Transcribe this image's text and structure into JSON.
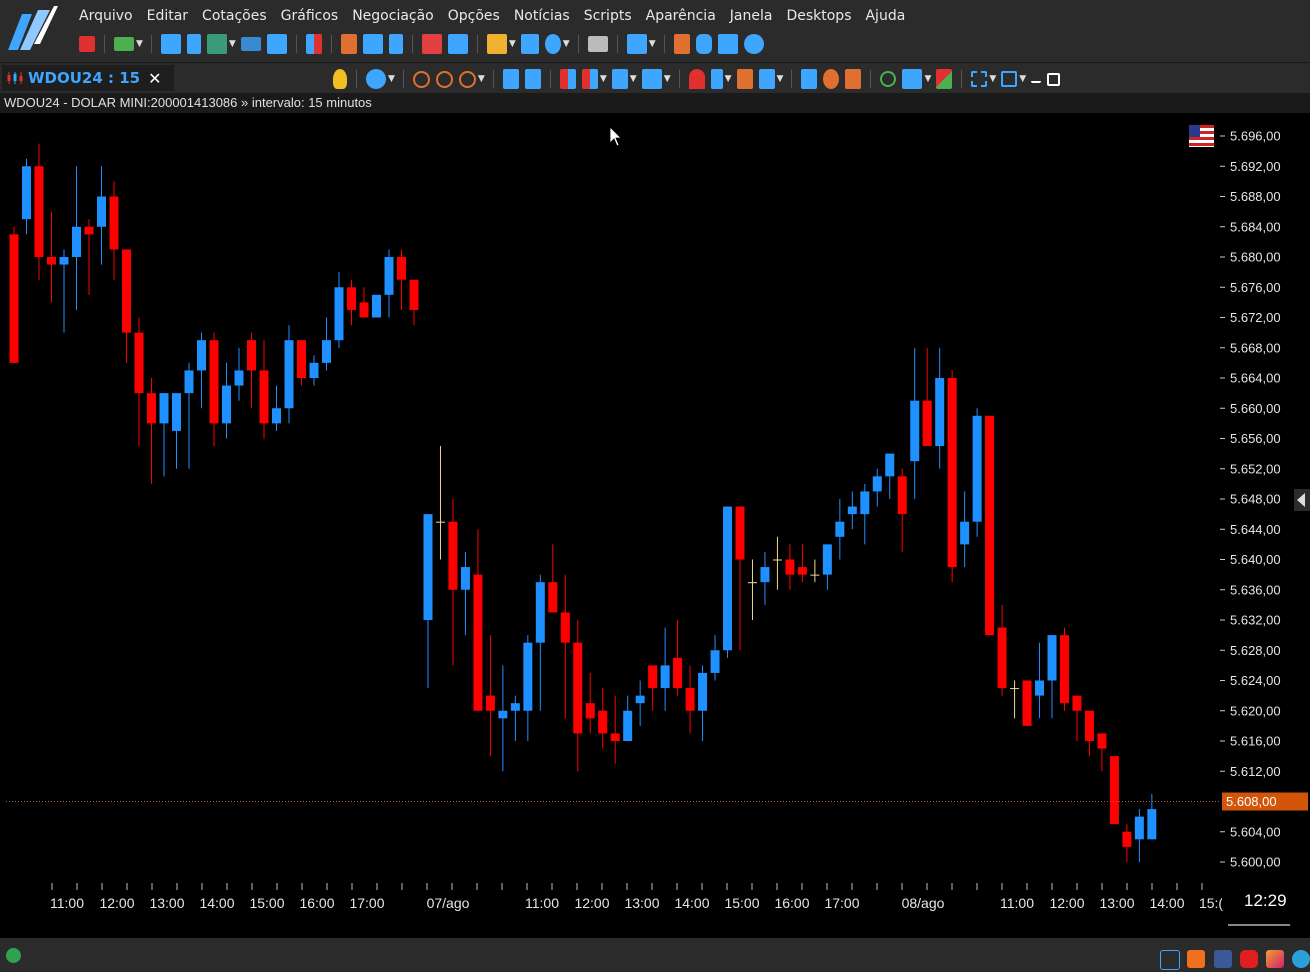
{
  "menu": {
    "items": [
      "Arquivo",
      "Editar",
      "Cotações",
      "Gráficos",
      "Negociação",
      "Opções",
      "Notícias",
      "Scripts",
      "Aparência",
      "Janela",
      "Desktops",
      "Ajuda"
    ]
  },
  "tab": {
    "label": "WDOU24 : 15"
  },
  "info": {
    "text": "WDOU24 - DOLAR MINI:200001413086 » intervalo: 15 minutos"
  },
  "chart_data": {
    "type": "candlestick",
    "ylim": [
      5597,
      5698
    ],
    "yticks": [
      "5.696,00",
      "5.692,00",
      "5.688,00",
      "5.684,00",
      "5.680,00",
      "5.676,00",
      "5.672,00",
      "5.668,00",
      "5.664,00",
      "5.660,00",
      "5.656,00",
      "5.652,00",
      "5.648,00",
      "5.644,00",
      "5.640,00",
      "5.636,00",
      "5.632,00",
      "5.628,00",
      "5.624,00",
      "5.620,00",
      "5.616,00",
      "5.612,00",
      "5.604,00",
      "5.600,00"
    ],
    "current_price_label": "5.608,00",
    "current_price": 5608,
    "xlabels": [
      "11:00",
      "12:00",
      "13:00",
      "14:00",
      "15:00",
      "16:00",
      "17:00",
      "07/ago",
      "11:00",
      "12:00",
      "13:00",
      "14:00",
      "15:00",
      "16:00",
      "17:00",
      "08/ago",
      "11:00",
      "12:00",
      "13:00",
      "14:00",
      "15:("
    ],
    "clock": "12:29",
    "up_color": "#1e90ff",
    "down_color": "#ff0000",
    "doji_color": "#f0d890",
    "candles": [
      [
        5683,
        5684,
        5666,
        5666
      ],
      [
        5685,
        5693,
        5683,
        5692
      ],
      [
        5692,
        5695,
        5677,
        5680
      ],
      [
        5680,
        5686,
        5674,
        5679
      ],
      [
        5679,
        5681,
        5670,
        5680
      ],
      [
        5680,
        5692,
        5673,
        5684
      ],
      [
        5684,
        5685,
        5675,
        5683
      ],
      [
        5684,
        5692,
        5679,
        5688
      ],
      [
        5688,
        5690,
        5677,
        5681
      ],
      [
        5681,
        5681,
        5666,
        5670
      ],
      [
        5670,
        5672,
        5655,
        5662
      ],
      [
        5662,
        5664,
        5650,
        5658
      ],
      [
        5658,
        5662,
        5651,
        5662
      ],
      [
        5657,
        5661,
        5652,
        5662
      ],
      [
        5662,
        5666,
        5652,
        5665
      ],
      [
        5665,
        5670,
        5660,
        5669
      ],
      [
        5669,
        5670,
        5655,
        5658
      ],
      [
        5658,
        5666,
        5656,
        5663
      ],
      [
        5663,
        5668,
        5661,
        5665
      ],
      [
        5669,
        5670,
        5660,
        5665
      ],
      [
        5665,
        5669,
        5656,
        5658
      ],
      [
        5658,
        5663,
        5657,
        5660
      ],
      [
        5660,
        5671,
        5658,
        5669
      ],
      [
        5669,
        5669,
        5663,
        5664
      ],
      [
        5664,
        5667,
        5663,
        5666
      ],
      [
        5666,
        5672,
        5665,
        5669
      ],
      [
        5669,
        5678,
        5668,
        5676
      ],
      [
        5676,
        5677,
        5671,
        5673
      ],
      [
        5674,
        5676,
        5672,
        5672
      ],
      [
        5672,
        5675,
        5672,
        5675
      ],
      [
        5675,
        5681,
        5672,
        5680
      ],
      [
        5680,
        5681,
        5673,
        5677
      ],
      [
        5677,
        5677,
        5671,
        5673
      ],
      [
        5632,
        5646,
        5623,
        5646
      ],
      [
        5645,
        5655,
        5640,
        5645
      ],
      [
        5645,
        5648,
        5626,
        5636
      ],
      [
        5636,
        5641,
        5630,
        5639
      ],
      [
        5638,
        5644,
        5620,
        5620
      ],
      [
        5622,
        5630,
        5614,
        5620
      ],
      [
        5619,
        5626,
        5612,
        5620
      ],
      [
        5620,
        5622,
        5616,
        5621
      ],
      [
        5620,
        5630,
        5616,
        5629
      ],
      [
        5629,
        5638,
        5620,
        5637
      ],
      [
        5637,
        5642,
        5633,
        5633
      ],
      [
        5633,
        5638,
        5619,
        5629
      ],
      [
        5629,
        5632,
        5612,
        5617
      ],
      [
        5621,
        5625,
        5617,
        5619
      ],
      [
        5620,
        5623,
        5615,
        5617
      ],
      [
        5617,
        5622,
        5613,
        5616
      ],
      [
        5616,
        5622,
        5616,
        5620
      ],
      [
        5621,
        5624,
        5618,
        5622
      ],
      [
        5626,
        5626,
        5620,
        5623
      ],
      [
        5623,
        5631,
        5620,
        5626
      ],
      [
        5627,
        5632,
        5622,
        5623
      ],
      [
        5623,
        5626,
        5617,
        5620
      ],
      [
        5620,
        5626,
        5616,
        5625
      ],
      [
        5625,
        5630,
        5624,
        5628
      ],
      [
        5628,
        5647,
        5627,
        5647
      ],
      [
        5647,
        5647,
        5628,
        5640
      ],
      [
        5637,
        5640,
        5632,
        5637
      ],
      [
        5637,
        5641,
        5634,
        5639
      ],
      [
        5640,
        5643,
        5636,
        5640
      ],
      [
        5640,
        5642,
        5636,
        5638
      ],
      [
        5639,
        5642,
        5637,
        5638
      ],
      [
        5638,
        5640,
        5637,
        5638
      ],
      [
        5638,
        5642,
        5636,
        5642
      ],
      [
        5643,
        5648,
        5640,
        5645
      ],
      [
        5646,
        5649,
        5644,
        5647
      ],
      [
        5646,
        5650,
        5642,
        5649
      ],
      [
        5649,
        5652,
        5647,
        5651
      ],
      [
        5651,
        5654,
        5648,
        5654
      ],
      [
        5651,
        5652,
        5641,
        5646
      ],
      [
        5653,
        5668,
        5648,
        5661
      ],
      [
        5661,
        5668,
        5655,
        5655
      ],
      [
        5655,
        5668,
        5652,
        5664
      ],
      [
        5664,
        5665,
        5637,
        5639
      ],
      [
        5642,
        5649,
        5639,
        5645
      ],
      [
        5645,
        5660,
        5643,
        5659
      ],
      [
        5659,
        5659,
        5630,
        5630
      ],
      [
        5631,
        5634,
        5622,
        5623
      ],
      [
        5623,
        5624,
        5619,
        5623
      ],
      [
        5624,
        5624,
        5618,
        5618
      ],
      [
        5622,
        5629,
        5619,
        5624
      ],
      [
        5624,
        5630,
        5619,
        5630
      ],
      [
        5630,
        5631,
        5620,
        5621
      ],
      [
        5622,
        5622,
        5616,
        5620
      ],
      [
        5620,
        5620,
        5614,
        5616
      ],
      [
        5617,
        5617,
        5612,
        5615
      ],
      [
        5614,
        5614,
        5605,
        5605
      ],
      [
        5604,
        5605,
        5600,
        5602
      ],
      [
        5603,
        5607,
        5600,
        5606
      ],
      [
        5603,
        5609,
        5603,
        5607
      ]
    ]
  }
}
